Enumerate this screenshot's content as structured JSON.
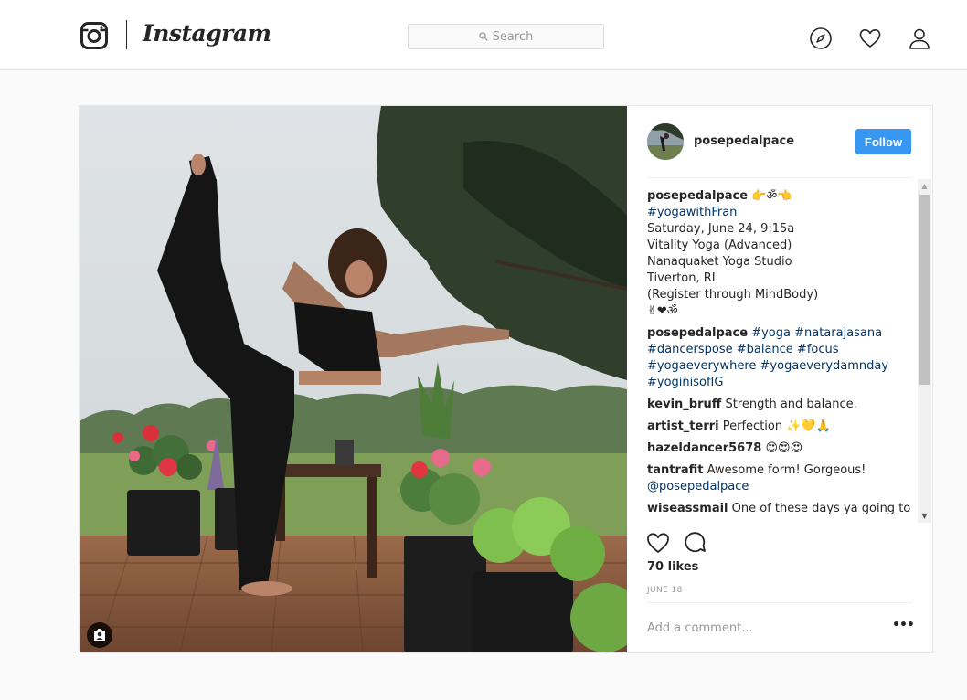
{
  "nav": {
    "wordmark": "Instagram",
    "search_placeholder": "Search",
    "icons": [
      "explore-compass-icon",
      "activity-heart-icon",
      "profile-person-icon"
    ]
  },
  "post": {
    "username": "posepedalpace",
    "follow_label": "Follow",
    "caption": {
      "username": "posepedalpace",
      "emoji": "👉ॐ👈",
      "lines": [
        "#yogawithFran",
        "Saturday, June 24, 9:15a",
        "Vitality Yoga (Advanced)",
        "Nanaquaket Yoga Studio",
        "Tiverton, RI",
        "(Register through MindBody)",
        "✌❤ॐ"
      ]
    },
    "hashtag_comment": {
      "username": "posepedalpace",
      "lines": [
        "#yoga #natarajasana",
        "#dancerspose #balance #focus",
        "#yogaeverywhere #yogaeverydamnday",
        "#yoginisofIG"
      ]
    },
    "comments": [
      {
        "user": "kevin_bruff",
        "text": "Strength and balance."
      },
      {
        "user": "artist_terri",
        "text": "Perfection ✨💛🙏"
      },
      {
        "user": "hazeldancer5678",
        "text": "😍😍😍"
      },
      {
        "user": "tantrafit",
        "text": "Awesome form! Gorgeous!",
        "line2": "@posepedalpace"
      },
      {
        "user": "wiseassmail",
        "text": "One of these days ya going to"
      }
    ],
    "likes": "70 likes",
    "date": "JUNE 18",
    "add_comment_placeholder": "Add a comment...",
    "more_label": "•••"
  },
  "colors": {
    "accent": "#3897f0",
    "hashtag": "#003569",
    "text": "#262626",
    "muted": "#999999",
    "background": "#fafafa"
  }
}
